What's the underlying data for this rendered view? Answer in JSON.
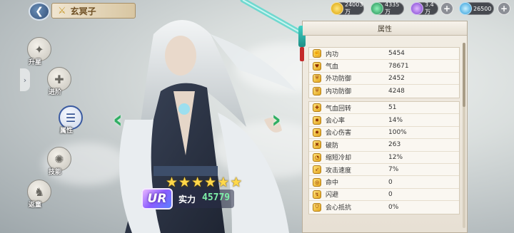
{
  "header": {
    "back_icon": "back-arrow-icon",
    "character_name": "玄冥子",
    "resources": [
      {
        "icon": "gold-coin-icon",
        "value": "24003万",
        "color": "#f5c518"
      },
      {
        "icon": "jade-icon",
        "value": "4335万",
        "color": "#2fb86b"
      },
      {
        "icon": "purple-orb-icon",
        "value": "3.4万",
        "color": "#9b5de5"
      },
      {
        "icon": "diamond-icon",
        "value": "26500",
        "color": "#54c3ff"
      }
    ]
  },
  "menu": [
    {
      "label": "升星",
      "icon": "star-icon",
      "active": false
    },
    {
      "label": "进阶",
      "icon": "sword-icon",
      "active": false
    },
    {
      "label": "属性",
      "icon": "list-icon",
      "active": true
    },
    {
      "label": "技能",
      "icon": "skill-icon",
      "active": false
    },
    {
      "label": "返童",
      "icon": "rocking-horse-icon",
      "active": false
    }
  ],
  "character": {
    "stars": 6,
    "rarity": "UR",
    "power_label": "实力",
    "power_value": "45779"
  },
  "panel": {
    "title": "属性",
    "basic_attributes": [
      {
        "name": "内功",
        "value": "5454"
      },
      {
        "name": "气血",
        "value": "78671"
      },
      {
        "name": "外功防御",
        "value": "2452"
      },
      {
        "name": "内功防御",
        "value": "4248"
      }
    ],
    "advanced_attributes": [
      {
        "name": "气血回转",
        "value": "51"
      },
      {
        "name": "会心率",
        "value": "14%"
      },
      {
        "name": "会心伤害",
        "value": "100%"
      },
      {
        "name": "破防",
        "value": "263"
      },
      {
        "name": "缩短冷却",
        "value": "12%"
      },
      {
        "name": "攻击速度",
        "value": "7%"
      },
      {
        "name": "命中",
        "value": "0"
      },
      {
        "name": "闪避",
        "value": "0"
      },
      {
        "name": "会心抵抗",
        "value": "0%"
      }
    ]
  }
}
